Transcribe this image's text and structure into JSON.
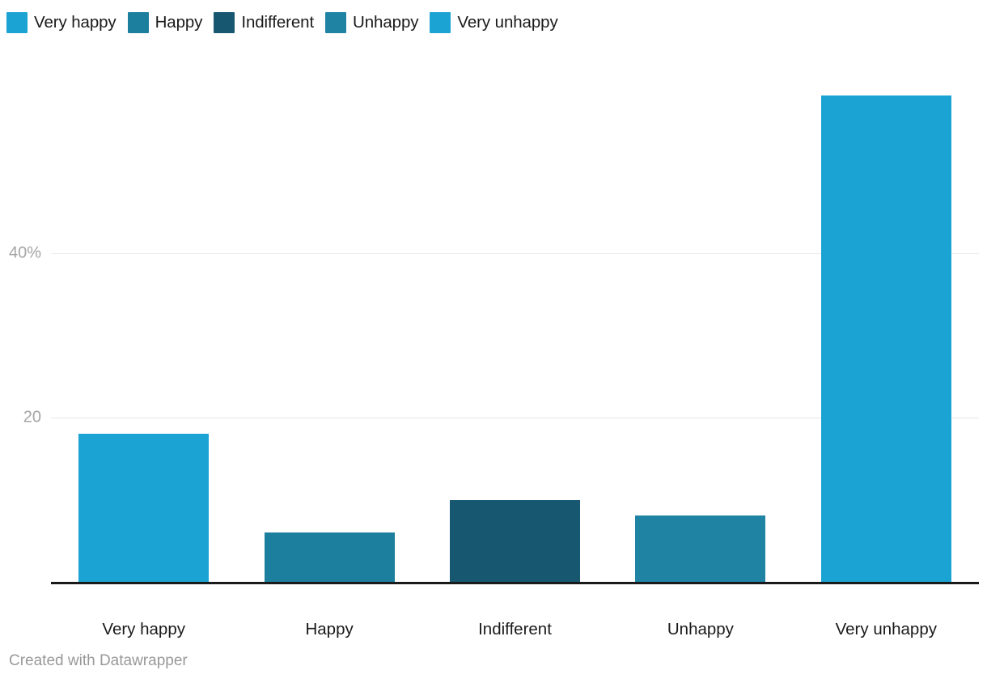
{
  "legend": {
    "items": [
      {
        "label": "Very happy",
        "color": "#1ba3d3"
      },
      {
        "label": "Happy",
        "color": "#1c7f9e"
      },
      {
        "label": "Indifferent",
        "color": "#17576f"
      },
      {
        "label": "Unhappy",
        "color": "#1f83a3"
      },
      {
        "label": "Very unhappy",
        "color": "#1ba3d3"
      }
    ]
  },
  "footer": {
    "credit": "Created with Datawrapper"
  },
  "axis": {
    "y_ticks": [
      {
        "label": "20",
        "value": 20
      },
      {
        "label": "40%",
        "value": 40
      }
    ]
  },
  "chart_data": {
    "type": "bar",
    "title": "",
    "subtitle": "",
    "xlabel": "",
    "ylabel": "",
    "categories": [
      "Very happy",
      "Happy",
      "Indifferent",
      "Unhappy",
      "Very unhappy"
    ],
    "values": [
      18.1,
      6.0,
      10.0,
      8.1,
      59.3
    ],
    "colors": [
      "#1ba3d3",
      "#1c7f9e",
      "#17576f",
      "#1f83a3",
      "#1ba3d3"
    ],
    "ylim": [
      0,
      65
    ],
    "y_tick_values": [
      20,
      40
    ],
    "y_tick_labels": [
      "20",
      "40%"
    ],
    "grid": true,
    "legend_position": "top",
    "legend_entries": [
      "Very happy",
      "Happy",
      "Indifferent",
      "Unhappy",
      "Very unhappy"
    ],
    "annotations": []
  }
}
